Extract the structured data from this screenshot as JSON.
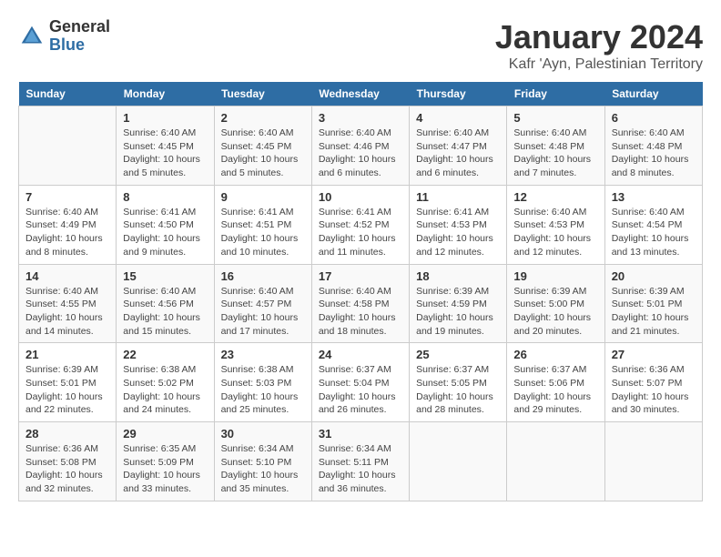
{
  "logo": {
    "general": "General",
    "blue": "Blue"
  },
  "title": "January 2024",
  "subtitle": "Kafr 'Ayn, Palestinian Territory",
  "weekdays": [
    "Sunday",
    "Monday",
    "Tuesday",
    "Wednesday",
    "Thursday",
    "Friday",
    "Saturday"
  ],
  "weeks": [
    [
      {
        "num": "",
        "info": ""
      },
      {
        "num": "1",
        "info": "Sunrise: 6:40 AM\nSunset: 4:45 PM\nDaylight: 10 hours\nand 5 minutes."
      },
      {
        "num": "2",
        "info": "Sunrise: 6:40 AM\nSunset: 4:45 PM\nDaylight: 10 hours\nand 5 minutes."
      },
      {
        "num": "3",
        "info": "Sunrise: 6:40 AM\nSunset: 4:46 PM\nDaylight: 10 hours\nand 6 minutes."
      },
      {
        "num": "4",
        "info": "Sunrise: 6:40 AM\nSunset: 4:47 PM\nDaylight: 10 hours\nand 6 minutes."
      },
      {
        "num": "5",
        "info": "Sunrise: 6:40 AM\nSunset: 4:48 PM\nDaylight: 10 hours\nand 7 minutes."
      },
      {
        "num": "6",
        "info": "Sunrise: 6:40 AM\nSunset: 4:48 PM\nDaylight: 10 hours\nand 8 minutes."
      }
    ],
    [
      {
        "num": "7",
        "info": "Sunrise: 6:40 AM\nSunset: 4:49 PM\nDaylight: 10 hours\nand 8 minutes."
      },
      {
        "num": "8",
        "info": "Sunrise: 6:41 AM\nSunset: 4:50 PM\nDaylight: 10 hours\nand 9 minutes."
      },
      {
        "num": "9",
        "info": "Sunrise: 6:41 AM\nSunset: 4:51 PM\nDaylight: 10 hours\nand 10 minutes."
      },
      {
        "num": "10",
        "info": "Sunrise: 6:41 AM\nSunset: 4:52 PM\nDaylight: 10 hours\nand 11 minutes."
      },
      {
        "num": "11",
        "info": "Sunrise: 6:41 AM\nSunset: 4:53 PM\nDaylight: 10 hours\nand 12 minutes."
      },
      {
        "num": "12",
        "info": "Sunrise: 6:40 AM\nSunset: 4:53 PM\nDaylight: 10 hours\nand 12 minutes."
      },
      {
        "num": "13",
        "info": "Sunrise: 6:40 AM\nSunset: 4:54 PM\nDaylight: 10 hours\nand 13 minutes."
      }
    ],
    [
      {
        "num": "14",
        "info": "Sunrise: 6:40 AM\nSunset: 4:55 PM\nDaylight: 10 hours\nand 14 minutes."
      },
      {
        "num": "15",
        "info": "Sunrise: 6:40 AM\nSunset: 4:56 PM\nDaylight: 10 hours\nand 15 minutes."
      },
      {
        "num": "16",
        "info": "Sunrise: 6:40 AM\nSunset: 4:57 PM\nDaylight: 10 hours\nand 17 minutes."
      },
      {
        "num": "17",
        "info": "Sunrise: 6:40 AM\nSunset: 4:58 PM\nDaylight: 10 hours\nand 18 minutes."
      },
      {
        "num": "18",
        "info": "Sunrise: 6:39 AM\nSunset: 4:59 PM\nDaylight: 10 hours\nand 19 minutes."
      },
      {
        "num": "19",
        "info": "Sunrise: 6:39 AM\nSunset: 5:00 PM\nDaylight: 10 hours\nand 20 minutes."
      },
      {
        "num": "20",
        "info": "Sunrise: 6:39 AM\nSunset: 5:01 PM\nDaylight: 10 hours\nand 21 minutes."
      }
    ],
    [
      {
        "num": "21",
        "info": "Sunrise: 6:39 AM\nSunset: 5:01 PM\nDaylight: 10 hours\nand 22 minutes."
      },
      {
        "num": "22",
        "info": "Sunrise: 6:38 AM\nSunset: 5:02 PM\nDaylight: 10 hours\nand 24 minutes."
      },
      {
        "num": "23",
        "info": "Sunrise: 6:38 AM\nSunset: 5:03 PM\nDaylight: 10 hours\nand 25 minutes."
      },
      {
        "num": "24",
        "info": "Sunrise: 6:37 AM\nSunset: 5:04 PM\nDaylight: 10 hours\nand 26 minutes."
      },
      {
        "num": "25",
        "info": "Sunrise: 6:37 AM\nSunset: 5:05 PM\nDaylight: 10 hours\nand 28 minutes."
      },
      {
        "num": "26",
        "info": "Sunrise: 6:37 AM\nSunset: 5:06 PM\nDaylight: 10 hours\nand 29 minutes."
      },
      {
        "num": "27",
        "info": "Sunrise: 6:36 AM\nSunset: 5:07 PM\nDaylight: 10 hours\nand 30 minutes."
      }
    ],
    [
      {
        "num": "28",
        "info": "Sunrise: 6:36 AM\nSunset: 5:08 PM\nDaylight: 10 hours\nand 32 minutes."
      },
      {
        "num": "29",
        "info": "Sunrise: 6:35 AM\nSunset: 5:09 PM\nDaylight: 10 hours\nand 33 minutes."
      },
      {
        "num": "30",
        "info": "Sunrise: 6:34 AM\nSunset: 5:10 PM\nDaylight: 10 hours\nand 35 minutes."
      },
      {
        "num": "31",
        "info": "Sunrise: 6:34 AM\nSunset: 5:11 PM\nDaylight: 10 hours\nand 36 minutes."
      },
      {
        "num": "",
        "info": ""
      },
      {
        "num": "",
        "info": ""
      },
      {
        "num": "",
        "info": ""
      }
    ]
  ]
}
